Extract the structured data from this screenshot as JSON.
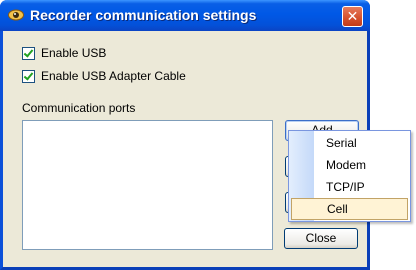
{
  "window": {
    "title": "Recorder communication settings",
    "close_glyph": "✕"
  },
  "checkboxes": [
    {
      "label": "Enable USB",
      "checked": true
    },
    {
      "label": "Enable USB Adapter Cable",
      "checked": true
    }
  ],
  "ports": {
    "label": "Communication ports",
    "items": []
  },
  "buttons": {
    "add": "Add",
    "close": "Close"
  },
  "add_menu": {
    "items": [
      "Serial",
      "Modem",
      "TCP/IP",
      "Cell"
    ],
    "highlighted": "Cell"
  },
  "colors": {
    "titlebar": "#0058e6",
    "dialog_bg": "#ece9d8",
    "menu_highlight": "#fff3d5",
    "check": "#21a121"
  }
}
